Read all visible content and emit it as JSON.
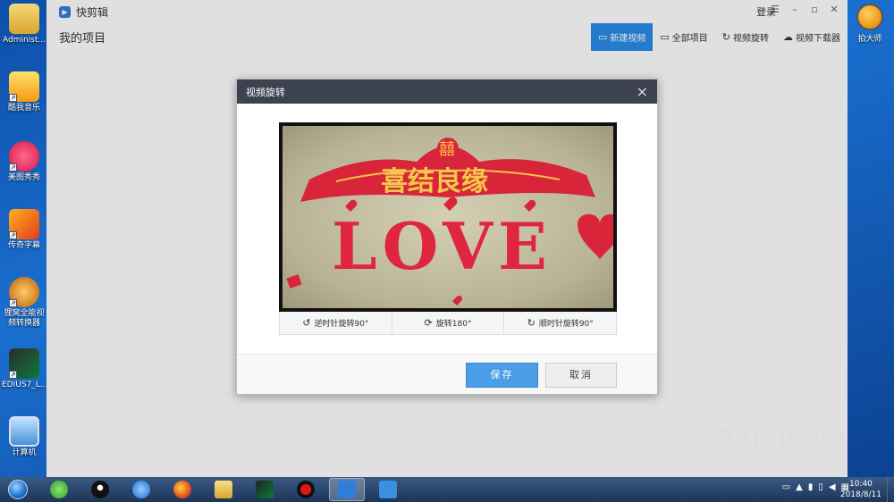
{
  "desktop": {
    "icons": [
      {
        "label": "Administ..."
      },
      {
        "label": "酷我音乐"
      },
      {
        "label": "美图秀秀"
      },
      {
        "label": "传奇字幕"
      },
      {
        "label": "狸窝全能视频转换器"
      },
      {
        "label": "EDIUS7_L..."
      },
      {
        "label": "计算机"
      }
    ],
    "right_icon_label": "拍大师"
  },
  "app": {
    "name": "快剪辑",
    "login": "登录",
    "page_title": "我的项目",
    "toolbar": {
      "new_video": "新建视频",
      "all_projects": "全部项目",
      "video_rotate": "视频旋转",
      "video_download": "视频下载器"
    }
  },
  "dialog": {
    "title": "视频旋转",
    "close": "×",
    "preview_text": {
      "couple_char": "囍",
      "banner": "喜结良缘",
      "love": "LOVE"
    },
    "rotate_ccw": "逆时针旋转90°",
    "rotate_180": "旋转180°",
    "rotate_cw": "顺时针旋转90°",
    "save": "保存",
    "cancel": "取消"
  },
  "watermark": {
    "main": "Baidu经验",
    "sub": "jingyan.baidu.com"
  },
  "taskbar": {
    "time": "10:40",
    "date": "2018/8/11"
  },
  "colors": {
    "accent": "#2b8ce8",
    "dialog_header": "#3d4250",
    "save_button": "#4a9de6",
    "desktop_bg": "#1a6fd0"
  }
}
